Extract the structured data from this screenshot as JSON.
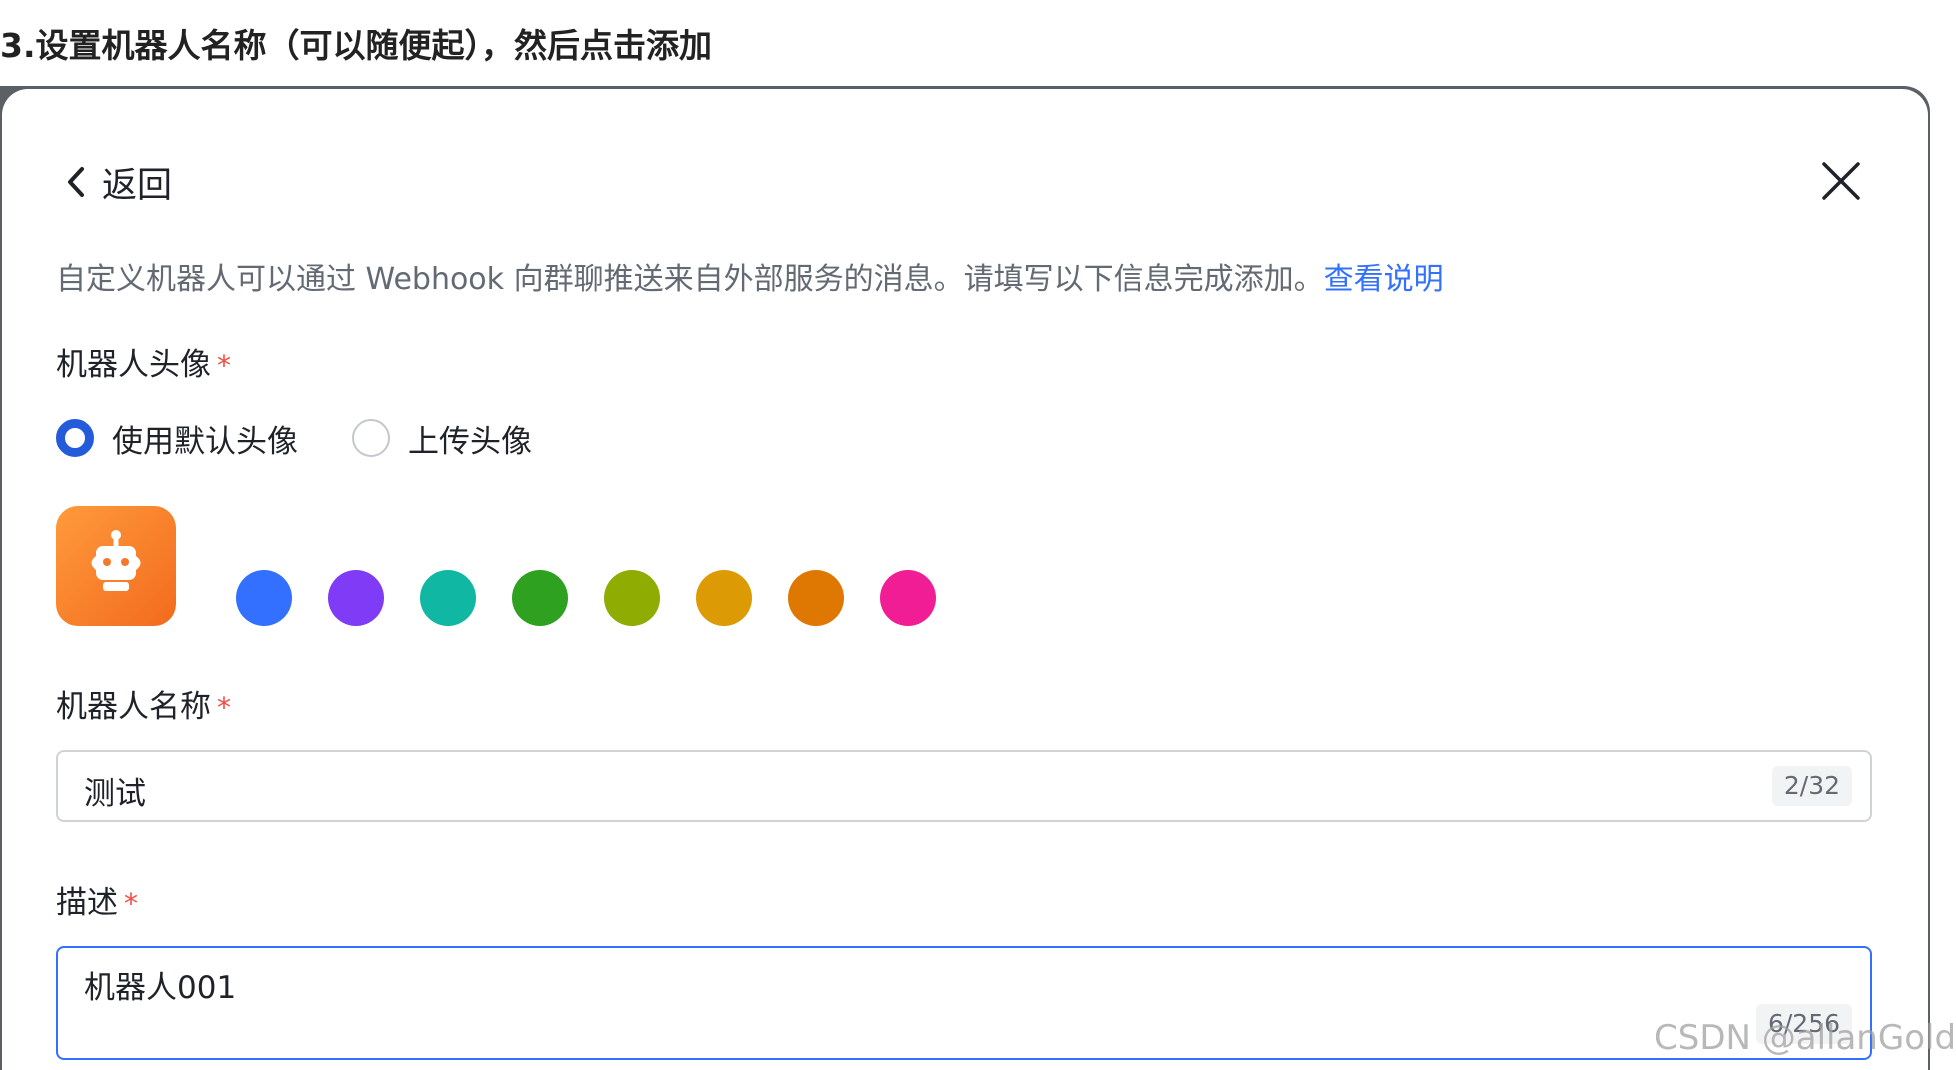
{
  "step_title": "3.设置机器人名称（可以随便起），然后点击添加",
  "dialog": {
    "back_label": "返回",
    "intro_text": "自定义机器人可以通过 Webhook 向群聊推送来自外部服务的消息。请填写以下信息完成添加。",
    "intro_link": "查看说明"
  },
  "avatar_section": {
    "label": "机器人头像",
    "required_mark": "*",
    "options": [
      {
        "label": "使用默认头像",
        "checked": true
      },
      {
        "label": "上传头像",
        "checked": false
      }
    ],
    "avatar_icon": "robot-icon",
    "avatar_color": "#F5792A",
    "swatch_colors": [
      "#3370FF",
      "#7F3BF5",
      "#10B7A3",
      "#2EA121",
      "#8FAC02",
      "#DC9B04",
      "#DE7802",
      "#F01D94"
    ]
  },
  "name_field": {
    "label": "机器人名称",
    "required_mark": "*",
    "value": "测试",
    "counter": "2/32"
  },
  "desc_field": {
    "label": "描述",
    "required_mark": "*",
    "value": "机器人001",
    "counter": "6/256"
  },
  "watermark": "CSDN @allanGold",
  "colors": {
    "accent": "#3370FF",
    "radio_checked": "#245BDB",
    "required": "#F54A45"
  }
}
